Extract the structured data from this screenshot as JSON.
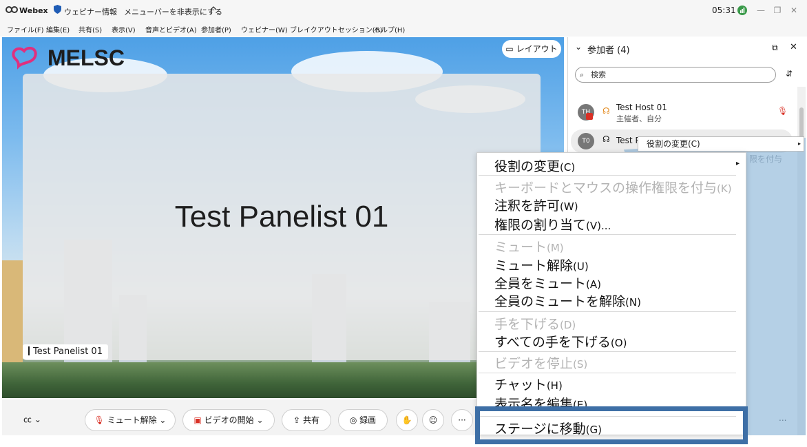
{
  "titlebar": {
    "app_name": "Webex",
    "webinar_info": "ウェビナー情報",
    "hide_menu": "メニューバーを非表示にする",
    "time": "05:31"
  },
  "menu": [
    "ファイル(F)",
    "編集(E)",
    "共有(S)",
    "表示(V)",
    "音声とビデオ(A)",
    "参加者(P)",
    "ウェビナー(W)",
    "ブレイクアウトセッション(B)",
    "ヘルプ(H)"
  ],
  "stage": {
    "logo_text": "MELSC",
    "layout_label": "レイアウト",
    "speaker_name": "Test Panelist 01",
    "name_tag": "Test Panelist 01"
  },
  "controls": {
    "unmute": "ミュート解除",
    "start_video": "ビデオの開始",
    "share": "共有",
    "record": "録画",
    "more": "···"
  },
  "panel": {
    "title": "参加者 (4)",
    "search_placeholder": "検索",
    "host_name": "Test Host 01",
    "host_role": "主催者、自分",
    "host_avatar": "TH",
    "p2_name": "Test P",
    "p2_avatar": "T0",
    "more": "..."
  },
  "submenu": {
    "role_change": "役割の変更(C)",
    "ghost": "限を付与"
  },
  "context_menu": {
    "items": [
      {
        "label": "役割の変更",
        "key": "(C)",
        "disabled": false
      },
      {
        "label": "キーボードとマウスの操作権限を付与",
        "key": "(K)",
        "disabled": true
      },
      {
        "label": "注釈を許可",
        "key": "(W)",
        "disabled": false
      },
      {
        "label": "権限の割り当て",
        "key": "(V)...",
        "disabled": false
      },
      {
        "label": "ミュート",
        "key": "(M)",
        "disabled": true
      },
      {
        "label": "ミュート解除",
        "key": "(U)",
        "disabled": false
      },
      {
        "label": "全員をミュート",
        "key": "(A)",
        "disabled": false
      },
      {
        "label": "全員のミュートを解除",
        "key": "(N)",
        "disabled": false
      },
      {
        "label": "手を下げる",
        "key": "(D)",
        "disabled": true
      },
      {
        "label": "すべての手を下げる",
        "key": "(O)",
        "disabled": false
      },
      {
        "label": "ビデオを停止",
        "key": "(S)",
        "disabled": true
      },
      {
        "label": "チャット",
        "key": "(H)",
        "disabled": false
      },
      {
        "label": "表示名を編集",
        "key": "(E)",
        "disabled": false
      },
      {
        "label": "ステージに移動",
        "key": "(G)",
        "disabled": false
      }
    ]
  },
  "colors": {
    "highlight_border": "#3e6fa6",
    "logo_pink": "#e0307e",
    "host_badge_red": "#d93025",
    "mic_red": "#d93025",
    "hand_orange": "#e48a1e",
    "record_green": "#3a9a4a"
  }
}
